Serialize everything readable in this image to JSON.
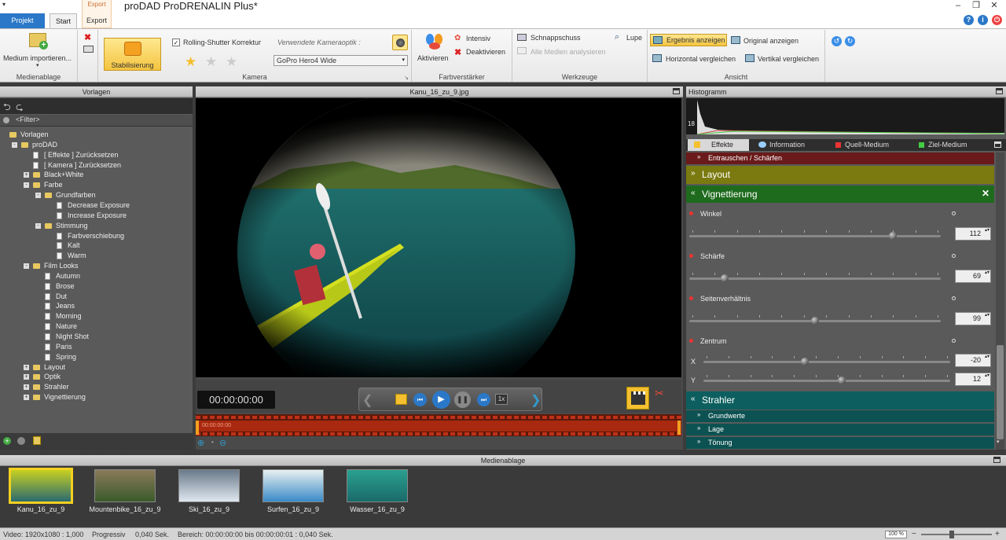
{
  "app": {
    "title": "proDAD ProDRENALIN Plus*",
    "context_tab": "Export"
  },
  "tabs": {
    "projekt": "Projekt",
    "start": "Start",
    "export": "Export"
  },
  "ribbon": {
    "medienablage": {
      "label": "Medienablage",
      "import": "Medium importieren..."
    },
    "stabilisierung": {
      "label": "Stabilisierung"
    },
    "kamera": {
      "label": "Kamera",
      "rolling_shutter": "Rolling-Shutter Korrektur",
      "optik_label": "Verwendete Kameraoptik :",
      "optik_value": "GoPro Hero4 Wide"
    },
    "farbverstaerker": {
      "label": "Farbverstärker",
      "aktivieren": "Aktivieren",
      "intensiv": "Intensiv",
      "deaktivieren": "Deaktivieren"
    },
    "werkzeuge": {
      "label": "Werkzeuge",
      "schnappschuss": "Schnappschuss",
      "lupe": "Lupe",
      "alle_medien": "Alle Medien analysieren"
    },
    "ansicht": {
      "label": "Ansicht",
      "ergebnis": "Ergebnis anzeigen",
      "original": "Original anzeigen",
      "horizontal": "Horizontal vergleichen",
      "vertikal": "Vertikal vergleichen"
    }
  },
  "vorlagen": {
    "title": "Vorlagen",
    "filter": "<Filter>",
    "tree": [
      {
        "label": "Vorlagen",
        "level": 0,
        "kind": "root"
      },
      {
        "label": "proDAD",
        "level": 1,
        "kind": "folder",
        "exp": "-"
      },
      {
        "label": "[ Effekte ]  Zurücksetzen",
        "level": 2,
        "kind": "doc"
      },
      {
        "label": "[ Kamera ]  Zurücksetzen",
        "level": 2,
        "kind": "doc"
      },
      {
        "label": "Black+White",
        "level": 2,
        "kind": "folder",
        "exp": "+"
      },
      {
        "label": "Farbe",
        "level": 2,
        "kind": "folder",
        "exp": "-"
      },
      {
        "label": "Grundfarben",
        "level": 3,
        "kind": "folder",
        "exp": "-"
      },
      {
        "label": "Decrease Exposure",
        "level": 4,
        "kind": "doc"
      },
      {
        "label": "Increase Exposure",
        "level": 4,
        "kind": "doc"
      },
      {
        "label": "Stimmung",
        "level": 3,
        "kind": "folder",
        "exp": "-"
      },
      {
        "label": "Farbverschiebung",
        "level": 4,
        "kind": "doc"
      },
      {
        "label": "Kalt",
        "level": 4,
        "kind": "doc"
      },
      {
        "label": "Warm",
        "level": 4,
        "kind": "doc"
      },
      {
        "label": "Film Looks",
        "level": 2,
        "kind": "folder",
        "exp": "-"
      },
      {
        "label": "Autumn",
        "level": 3,
        "kind": "doc"
      },
      {
        "label": "Brose",
        "level": 3,
        "kind": "doc"
      },
      {
        "label": "Dut",
        "level": 3,
        "kind": "doc"
      },
      {
        "label": "Jeans",
        "level": 3,
        "kind": "doc"
      },
      {
        "label": "Morning",
        "level": 3,
        "kind": "doc"
      },
      {
        "label": "Nature",
        "level": 3,
        "kind": "doc"
      },
      {
        "label": "Night Shot",
        "level": 3,
        "kind": "doc"
      },
      {
        "label": "Paris",
        "level": 3,
        "kind": "doc"
      },
      {
        "label": "Spring",
        "level": 3,
        "kind": "doc"
      },
      {
        "label": "Layout",
        "level": 2,
        "kind": "folder",
        "exp": "+"
      },
      {
        "label": "Optik",
        "level": 2,
        "kind": "folder",
        "exp": "+"
      },
      {
        "label": "Strahler",
        "level": 2,
        "kind": "folder",
        "exp": "+"
      },
      {
        "label": "Vignettierung",
        "level": 2,
        "kind": "folder",
        "exp": "+"
      }
    ]
  },
  "preview": {
    "filename": "Kanu_16_zu_9.jpg",
    "timecode": "00:00:00:00",
    "speed": "1x",
    "timeline_tc": "00:00:00:00"
  },
  "histogram": {
    "title": "Histogramm",
    "value": "18"
  },
  "effects_tabs": {
    "effekte": "Effekte",
    "information": "Information",
    "quell": "Quell-Medium",
    "ziel": "Ziel-Medium"
  },
  "effects": {
    "entrauschen": "Entrauschen / Schärfen",
    "layout": "Layout",
    "vignettierung": "Vignettierung",
    "params": [
      {
        "name": "Winkel",
        "value": "112",
        "pos": 0.81
      },
      {
        "name": "Schärfe",
        "value": "69",
        "pos": 0.14
      },
      {
        "name": "Seitenverhältnis",
        "value": "99",
        "pos": 0.5
      }
    ],
    "zentrum": {
      "name": "Zentrum",
      "x_label": "X",
      "x_value": "-20",
      "x_pos": 0.41,
      "y_label": "Y",
      "y_value": "12",
      "y_pos": 0.56
    },
    "strahler": "Strahler",
    "grundwerte": "Grundwerte",
    "lage": "Lage",
    "toenung": "Tönung"
  },
  "media": {
    "title": "Medienablage",
    "items": [
      {
        "label": "Kanu_16_zu_9"
      },
      {
        "label": "Mountenbike_16_zu_9"
      },
      {
        "label": "Ski_16_zu_9"
      },
      {
        "label": "Surfen_16_zu_9"
      },
      {
        "label": "Wasser_16_zu_9"
      }
    ]
  },
  "status": {
    "video": "Video: 1920x1080 : 1,000",
    "mode": "Progressiv",
    "dur": "0,040 Sek.",
    "range": "Bereich: 00:00:00:00 bis 00:00:00:01 : 0,040 Sek.",
    "zoom": "100 %"
  },
  "colors": {
    "accent": "#2b78c8",
    "vignette_header": "#1e6b1e",
    "layout_header": "#7a7a10",
    "strahler_header": "#0d5f5f"
  }
}
